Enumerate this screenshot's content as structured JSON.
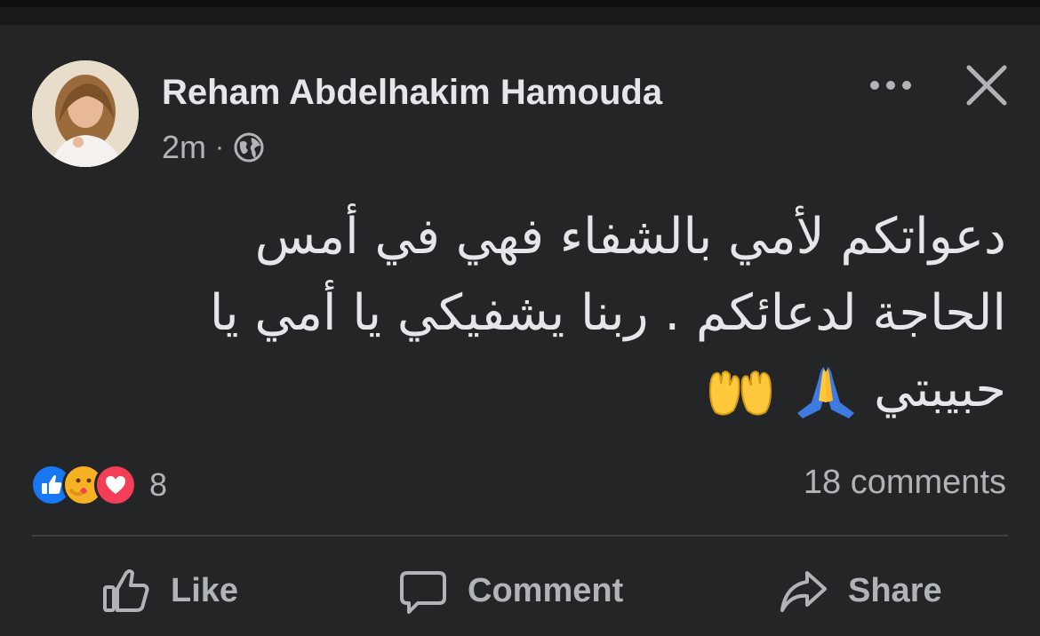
{
  "post": {
    "author": "Reham Abdelhakim Hamouda",
    "time": "2m",
    "separator": "·",
    "privacy_icon": "globe-icon",
    "text_line1": "دعواتكم لأمي بالشفاء فهي في أمس",
    "text_line2": "الحاجة لدعائكم . ربنا يشفيكي يا أمي يا",
    "text_line3": "حبيبتي"
  },
  "reactions": {
    "icons": [
      "like-reaction-icon",
      "care-reaction-icon",
      "love-reaction-icon"
    ],
    "count": "8"
  },
  "comments": {
    "count_label": "18 comments"
  },
  "actions": {
    "like": "Like",
    "comment": "Comment",
    "share": "Share"
  },
  "colors": {
    "background": "#242526",
    "text": "#e4e6eb",
    "muted": "#b0b3b8",
    "like_blue": "#1877f2",
    "love_red": "#f33e58"
  }
}
